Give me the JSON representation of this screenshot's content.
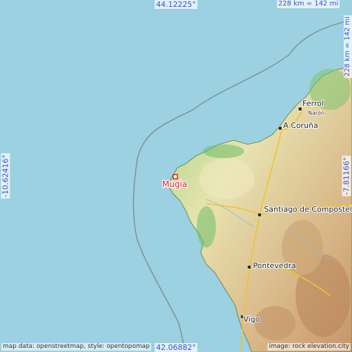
{
  "coordinates": {
    "north": "44.12225°",
    "south": "42.06882°",
    "west": "-10.62416°",
    "east": "-7.81166°"
  },
  "scale": {
    "horizontal": "228 km = 142 mi",
    "vertical": "228 km = 142 mi"
  },
  "places": {
    "highlight": "Mugia",
    "ferrol": "Ferrol",
    "naron": "Narón",
    "a_coruna": "A Coruña",
    "santiago": "Santiago de Compostela",
    "pontevedra": "Pontevedra",
    "vigo": "Vigo"
  },
  "attribution": {
    "left": "map data: openstreetmap, style: opentopomap",
    "right": "image: rock elevation.city"
  },
  "colors": {
    "sea": "#9bd1e0",
    "highlight": "#e0192b",
    "coords": "#3a4fd6"
  }
}
